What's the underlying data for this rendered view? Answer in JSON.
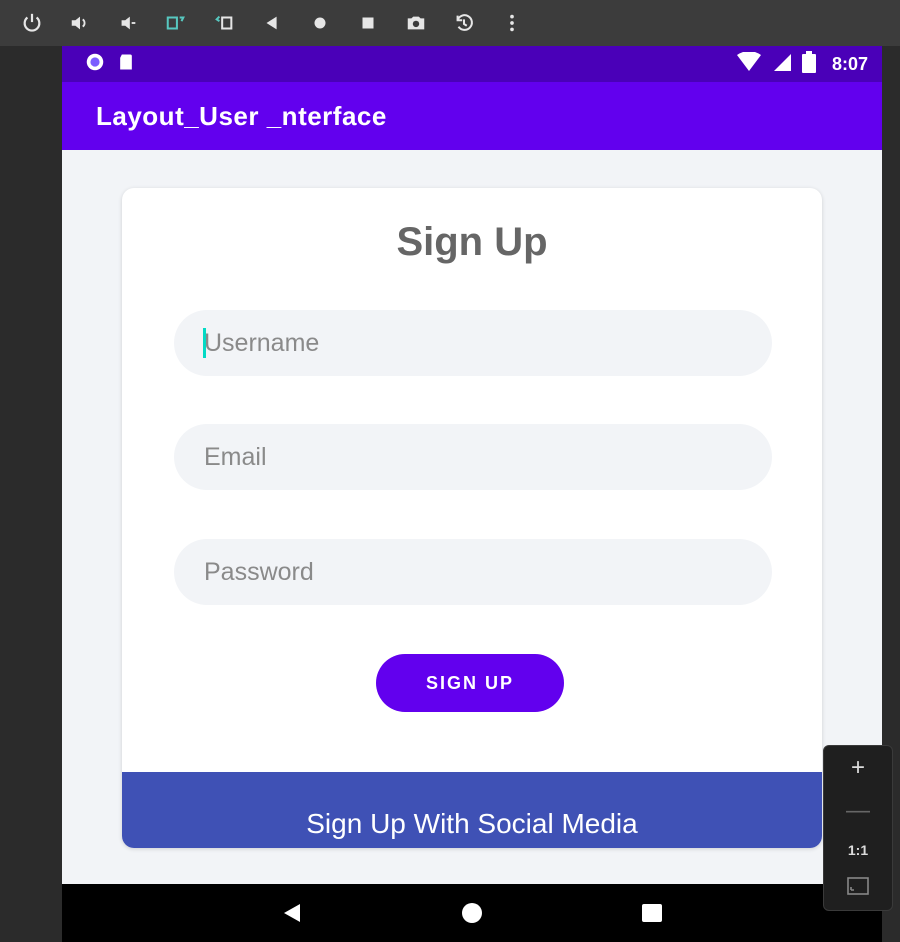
{
  "emulator": {
    "toolbar_icons": [
      "power-icon",
      "volume-up-icon",
      "volume-down-icon",
      "rotate-left-icon",
      "rotate-right-icon",
      "back-icon",
      "home-icon",
      "overview-icon",
      "camera-icon",
      "zoom-history-icon",
      "more-icon"
    ],
    "zoom": {
      "zoom_in_label": "+",
      "zoom_out_label": "—",
      "one_to_one_label": "1:1"
    }
  },
  "status_bar": {
    "time": "8:07"
  },
  "app_bar": {
    "title": "Layout_User _nterface"
  },
  "form": {
    "title": "Sign Up",
    "username_placeholder": "Username",
    "email_placeholder": "Email",
    "password_placeholder": "Password",
    "submit_label": "SIGN UP",
    "social_label": "Sign Up With Social Media"
  },
  "colors": {
    "primary": "#6200ee",
    "status_bar": "#4a00b8",
    "social_bar": "#3f51b5",
    "background": "#f2f4f7",
    "caret": "#03dac5"
  }
}
